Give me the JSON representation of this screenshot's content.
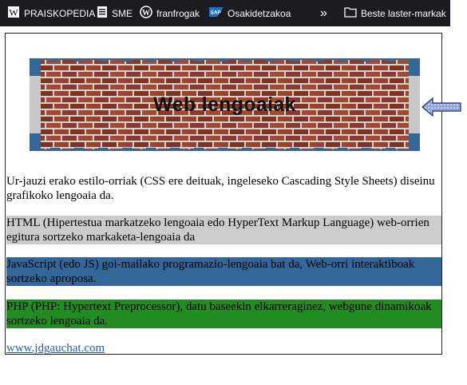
{
  "bookmarks": [
    {
      "label": "PRAISKOPEDIA",
      "icon": "wiki-w-icon"
    },
    {
      "label": "SME",
      "icon": "document-icon"
    },
    {
      "label": "franfrogak",
      "icon": "wordpress-icon"
    },
    {
      "label": "Osakidetzakoa",
      "icon": "sap-logo-icon"
    }
  ],
  "bookmarks_more": "»",
  "other_bookmarks": "Beste laster-markak",
  "banner": {
    "title": "Web lengoaiak"
  },
  "paragraphs": {
    "intro": "Ur-jauzi erako estilo-orriak (CSS ere deituak, ingeleseko Cascading Style Sheets) diseinu grafikoko lengoaia da.",
    "html": "HTML (Hipertestua markatzeko lengoaia edo HyperText Markup Language) web-orrien egitura sortzeko markaketa-lengoaia da",
    "js": "JavaScript (edo JS) goi-mailako programazio-lengoaia bat da, Web-orri interaktiboak sortzeko aproposa.",
    "php": "PHP (PHP: Hypertext Preprocessor), datu baseekin elkarreraginez, webgune dinamikoak sortzeko lengoaia da."
  },
  "link": "www.jdgauchat.com",
  "colors": {
    "html_bg": "#cccccc",
    "js_bg": "#336699",
    "php_bg": "#228b22",
    "banner_frame": "#336699",
    "link": "#2a5db0"
  }
}
